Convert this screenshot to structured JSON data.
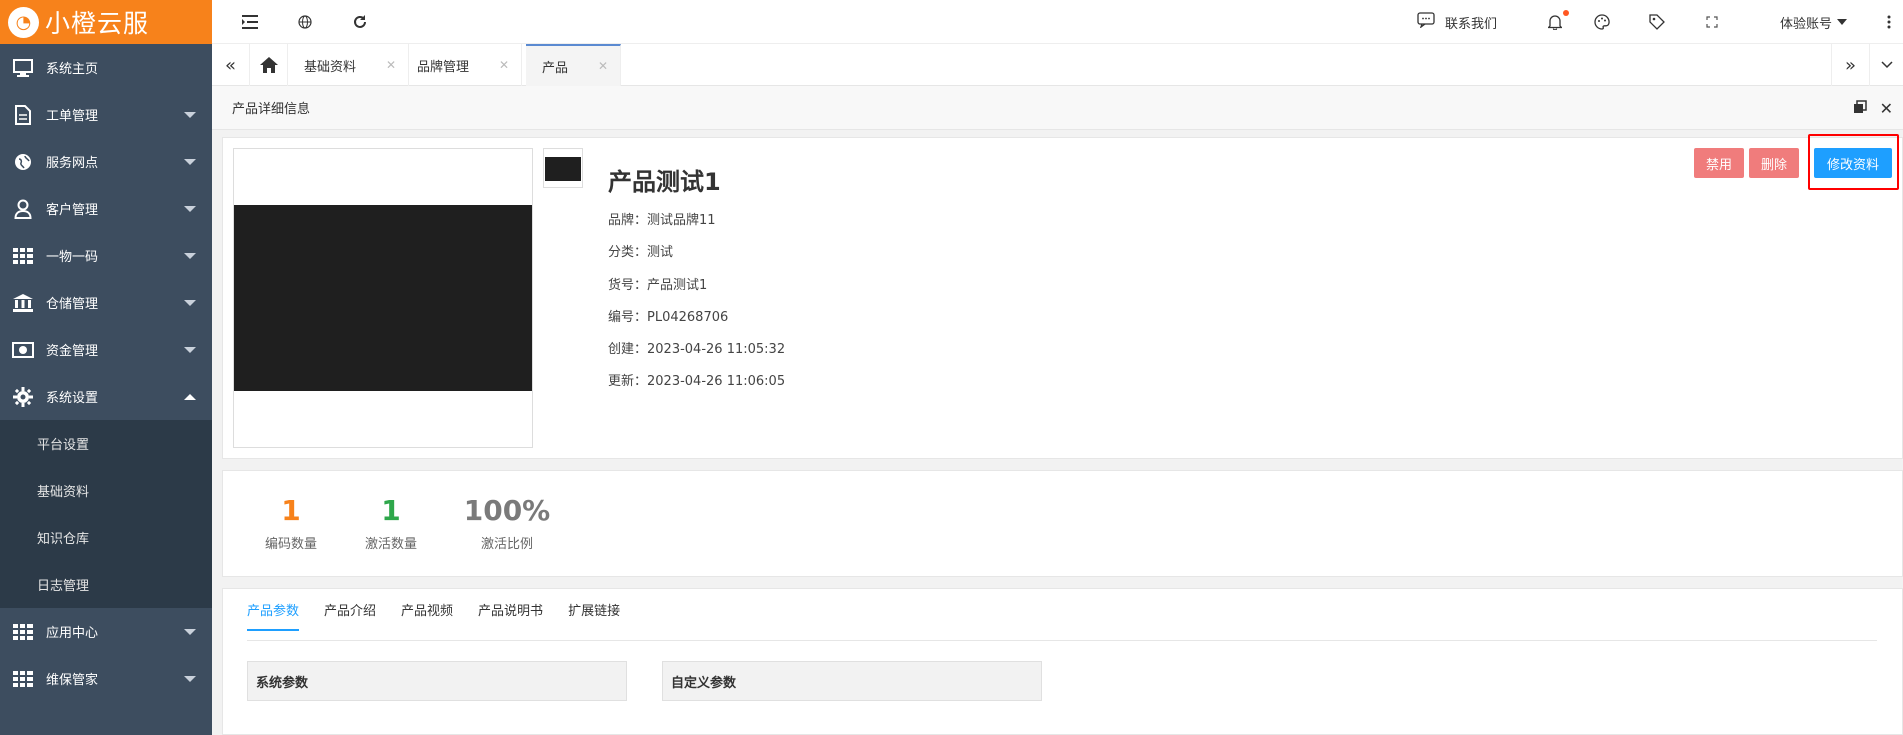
{
  "app": {
    "logo_text": "小橙云服",
    "brand_color": "#f7821b"
  },
  "sidebar": {
    "items": [
      {
        "label": "系统主页",
        "icon": "monitor-icon"
      },
      {
        "label": "工单管理",
        "icon": "document-icon"
      },
      {
        "label": "服务网点",
        "icon": "globe-icon"
      },
      {
        "label": "客户管理",
        "icon": "user-icon"
      },
      {
        "label": "一物一码",
        "icon": "grid-icon"
      },
      {
        "label": "仓储管理",
        "icon": "bank-icon"
      },
      {
        "label": "资金管理",
        "icon": "money-icon"
      },
      {
        "label": "系统设置",
        "icon": "gear-icon"
      }
    ],
    "submenu": [
      "平台设置",
      "基础资料",
      "知识仓库",
      "日志管理"
    ],
    "after": [
      {
        "label": "应用中心",
        "icon": "grid-icon"
      },
      {
        "label": "维保管家",
        "icon": "grid-icon"
      }
    ]
  },
  "topbar": {
    "contact_label": "联系我们",
    "account_label": "体验账号"
  },
  "tabs": [
    {
      "label": "基础资料"
    },
    {
      "label": "品牌管理"
    },
    {
      "label": "产品"
    }
  ],
  "page": {
    "header": "产品详细信息"
  },
  "product": {
    "title": "产品测试1",
    "fields": [
      {
        "label": "品牌：",
        "value": "测试品牌11"
      },
      {
        "label": "分类：",
        "value": "测试"
      },
      {
        "label": "货号：",
        "value": "产品测试1"
      },
      {
        "label": "编号：",
        "value": "PL04268706"
      },
      {
        "label": "创建：",
        "value": "2023-04-26 11:05:32"
      },
      {
        "label": "更新：",
        "value": "2023-04-26 11:06:05"
      }
    ]
  },
  "actions": {
    "disable": "禁用",
    "delete": "删除",
    "edit": "修改资料"
  },
  "stats": [
    {
      "value": "1",
      "label": "编码数量",
      "color": "#f7821b"
    },
    {
      "value": "1",
      "label": "激活数量",
      "color": "#2fa74b"
    },
    {
      "value": "100%",
      "label": "激活比例",
      "color": "#7a7a7a"
    }
  ],
  "detail_tabs": [
    "产品参数",
    "产品介绍",
    "产品视频",
    "产品说明书",
    "扩展链接"
  ],
  "param_boxes": {
    "system": "系统参数",
    "custom": "自定义参数"
  }
}
